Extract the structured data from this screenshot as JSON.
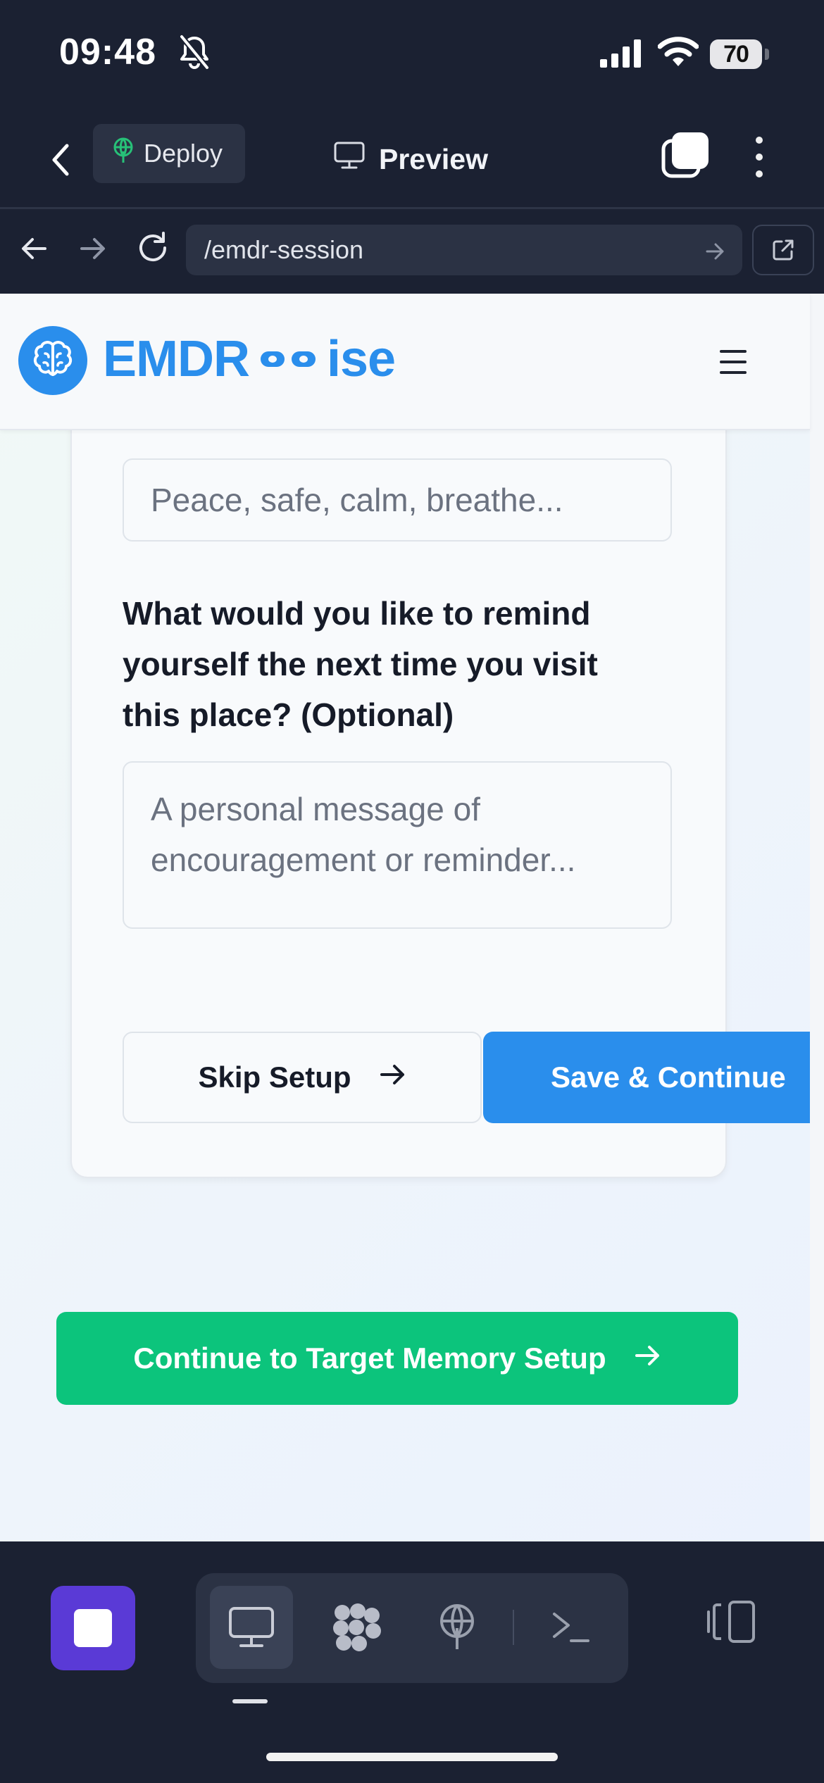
{
  "status_bar": {
    "time": "09:48",
    "battery": "70",
    "icons": [
      "bell-slash-icon",
      "signal-bars-icon",
      "wifi-icon",
      "battery-icon"
    ]
  },
  "top_bar": {
    "deploy_label": "Deploy",
    "preview_label": "Preview",
    "icons": [
      "chevron-left-icon",
      "deploy-icon",
      "monitor-icon",
      "tabs-icon",
      "more-vertical-icon"
    ]
  },
  "url_bar": {
    "url": "/emdr-session",
    "icons": [
      "arrow-left-icon",
      "arrow-right-icon",
      "reload-icon",
      "arrow-right-icon",
      "external-link-icon"
    ]
  },
  "app": {
    "logo_prefix": "EMDR",
    "logo_suffix": "ise",
    "brand_color": "#2a8eec",
    "form": {
      "feeling_placeholder": "Peace, safe, calm, breathe...",
      "reminder_label": "What would you like to remind yourself the next time you visit this place? (Optional)",
      "reminder_placeholder": "A personal message of encouragement or reminder...",
      "skip_label": "Skip Setup",
      "save_label": "Save & Continue"
    },
    "continue_label": "Continue to Target Memory Setup",
    "continue_color": "#0cc47c"
  },
  "bottom_bar": {
    "icons": [
      "stop-icon",
      "monitor-icon",
      "agent-icon",
      "deploy-icon",
      "terminal-icon",
      "layout-icon"
    ],
    "stop_color": "#5a3ad6"
  }
}
